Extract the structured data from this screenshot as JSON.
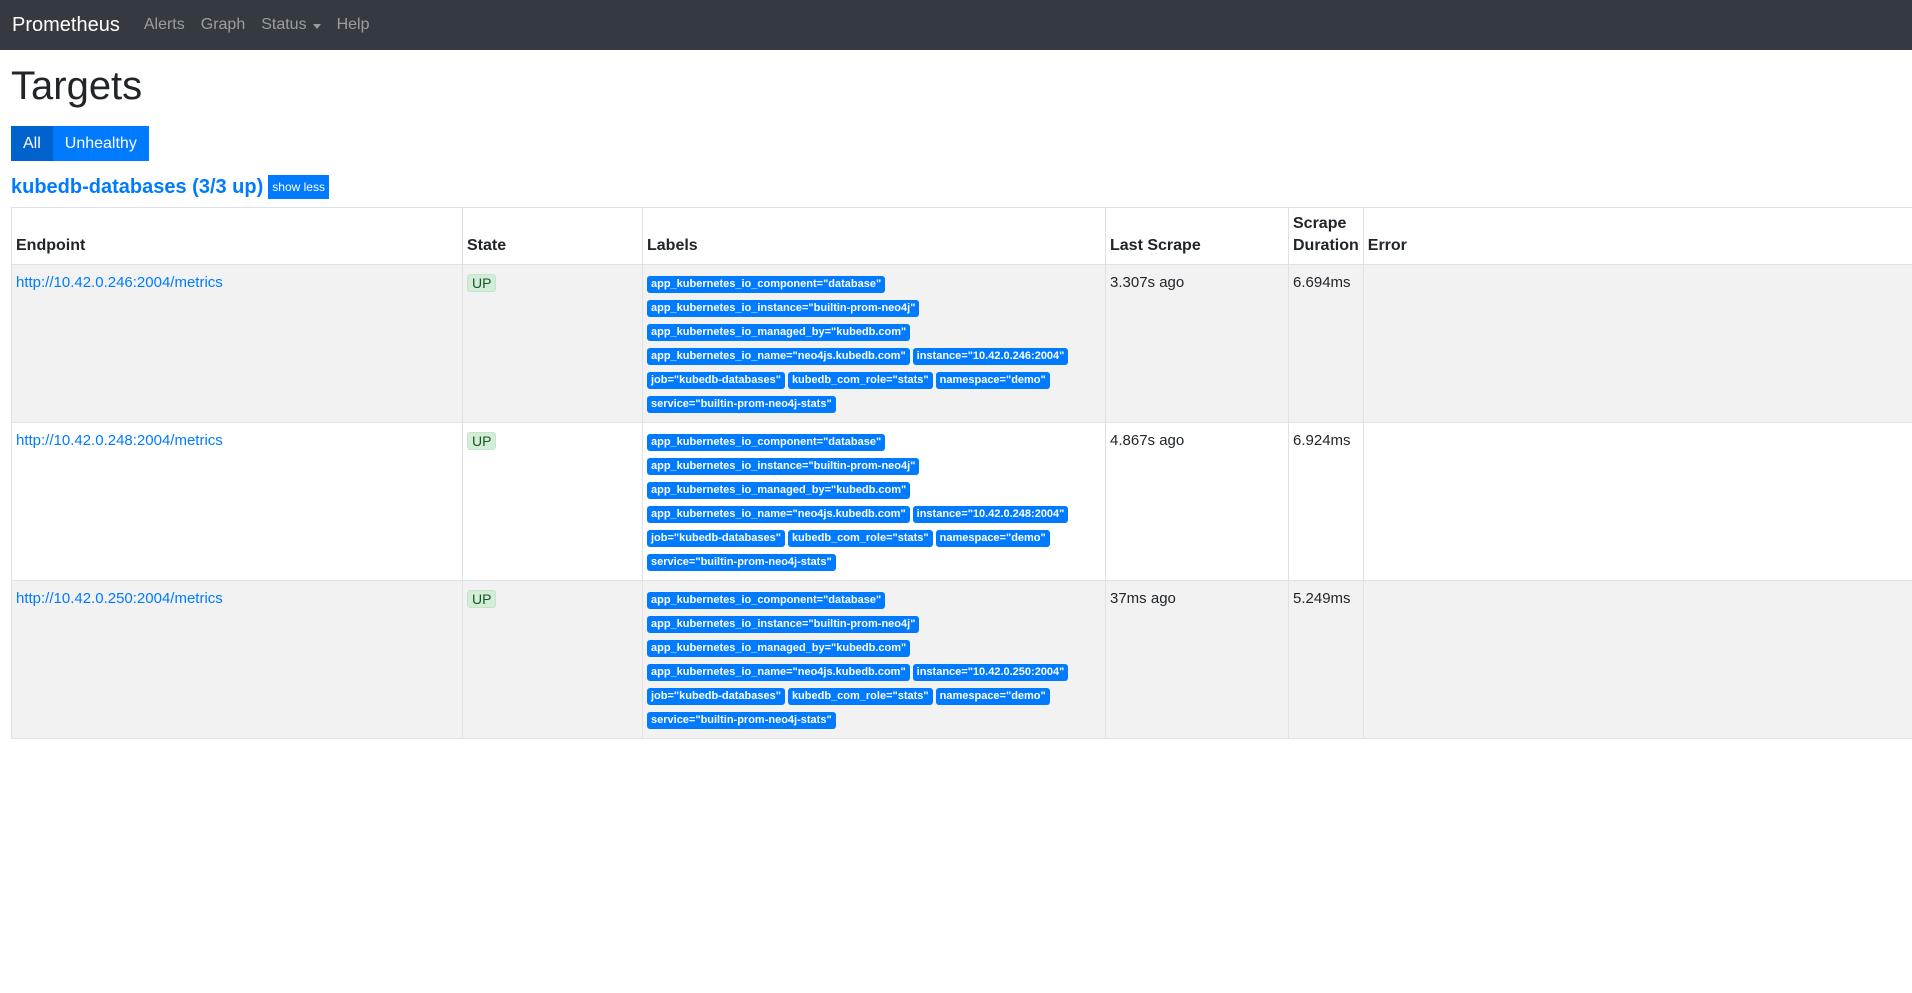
{
  "nav": {
    "brand": "Prometheus",
    "items": [
      {
        "label": "Alerts"
      },
      {
        "label": "Graph"
      },
      {
        "label": "Status",
        "dropdown": true
      },
      {
        "label": "Help"
      }
    ]
  },
  "page": {
    "title": "Targets",
    "filters": {
      "all": "All",
      "unhealthy": "Unhealthy"
    }
  },
  "job": {
    "title": "kubedb-databases (3/3 up)",
    "toggle_label": "show less"
  },
  "table": {
    "headers": {
      "endpoint": "Endpoint",
      "state": "State",
      "labels": "Labels",
      "last_scrape": "Last Scrape",
      "scrape_duration_1": "Scrape",
      "scrape_duration_2": "Duration",
      "error": "Error"
    },
    "rows": [
      {
        "endpoint": "http://10.42.0.246:2004/metrics",
        "state": "UP",
        "labels": [
          "app_kubernetes_io_component=\"database\"",
          "app_kubernetes_io_instance=\"builtin-prom-neo4j\"",
          "app_kubernetes_io_managed_by=\"kubedb.com\"",
          "app_kubernetes_io_name=\"neo4js.kubedb.com\"",
          "instance=\"10.42.0.246:2004\"",
          "job=\"kubedb-databases\"",
          "kubedb_com_role=\"stats\"",
          "namespace=\"demo\"",
          "service=\"builtin-prom-neo4j-stats\""
        ],
        "last_scrape": "3.307s ago",
        "scrape_duration": "6.694ms",
        "error": ""
      },
      {
        "endpoint": "http://10.42.0.248:2004/metrics",
        "state": "UP",
        "labels": [
          "app_kubernetes_io_component=\"database\"",
          "app_kubernetes_io_instance=\"builtin-prom-neo4j\"",
          "app_kubernetes_io_managed_by=\"kubedb.com\"",
          "app_kubernetes_io_name=\"neo4js.kubedb.com\"",
          "instance=\"10.42.0.248:2004\"",
          "job=\"kubedb-databases\"",
          "kubedb_com_role=\"stats\"",
          "namespace=\"demo\"",
          "service=\"builtin-prom-neo4j-stats\""
        ],
        "last_scrape": "4.867s ago",
        "scrape_duration": "6.924ms",
        "error": ""
      },
      {
        "endpoint": "http://10.42.0.250:2004/metrics",
        "state": "UP",
        "labels": [
          "app_kubernetes_io_component=\"database\"",
          "app_kubernetes_io_instance=\"builtin-prom-neo4j\"",
          "app_kubernetes_io_managed_by=\"kubedb.com\"",
          "app_kubernetes_io_name=\"neo4js.kubedb.com\"",
          "instance=\"10.42.0.250:2004\"",
          "job=\"kubedb-databases\"",
          "kubedb_com_role=\"stats\"",
          "namespace=\"demo\"",
          "service=\"builtin-prom-neo4j-stats\""
        ],
        "last_scrape": "37ms ago",
        "scrape_duration": "5.249ms",
        "error": ""
      }
    ]
  },
  "colors": {
    "navbar": "#343a40",
    "primary": "#007bff",
    "active": "#0062cc",
    "up_badge": "#d4edda"
  }
}
